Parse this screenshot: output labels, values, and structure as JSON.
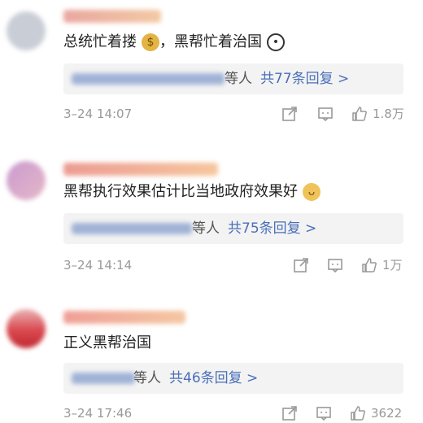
{
  "comments": [
    {
      "text": "总统忙着搂",
      "text_after": "，黑帮忙着治国",
      "emoji_1": "money-bag",
      "emoji_2": "panda-face",
      "replies": {
        "who": "等人",
        "summary": "共77条回复 >"
      },
      "timestamp": "3–24 14:07",
      "likes": "1.8万"
    },
    {
      "text": "黑帮执行效果估计比当地政府效果好",
      "emoji_1": "doge-face",
      "replies": {
        "who": "等人",
        "summary": "共75条回复 >"
      },
      "timestamp": "3–24 14:14",
      "likes": "1万"
    },
    {
      "text": "正义黑帮治国",
      "replies": {
        "who": "等人",
        "summary": "共46条回复 >"
      },
      "timestamp": "3–24 17:46",
      "likes": "3622"
    }
  ],
  "colors": {
    "link": "#4a6fb8",
    "meta": "#999999",
    "reply_bg": "#f3f3f3"
  }
}
